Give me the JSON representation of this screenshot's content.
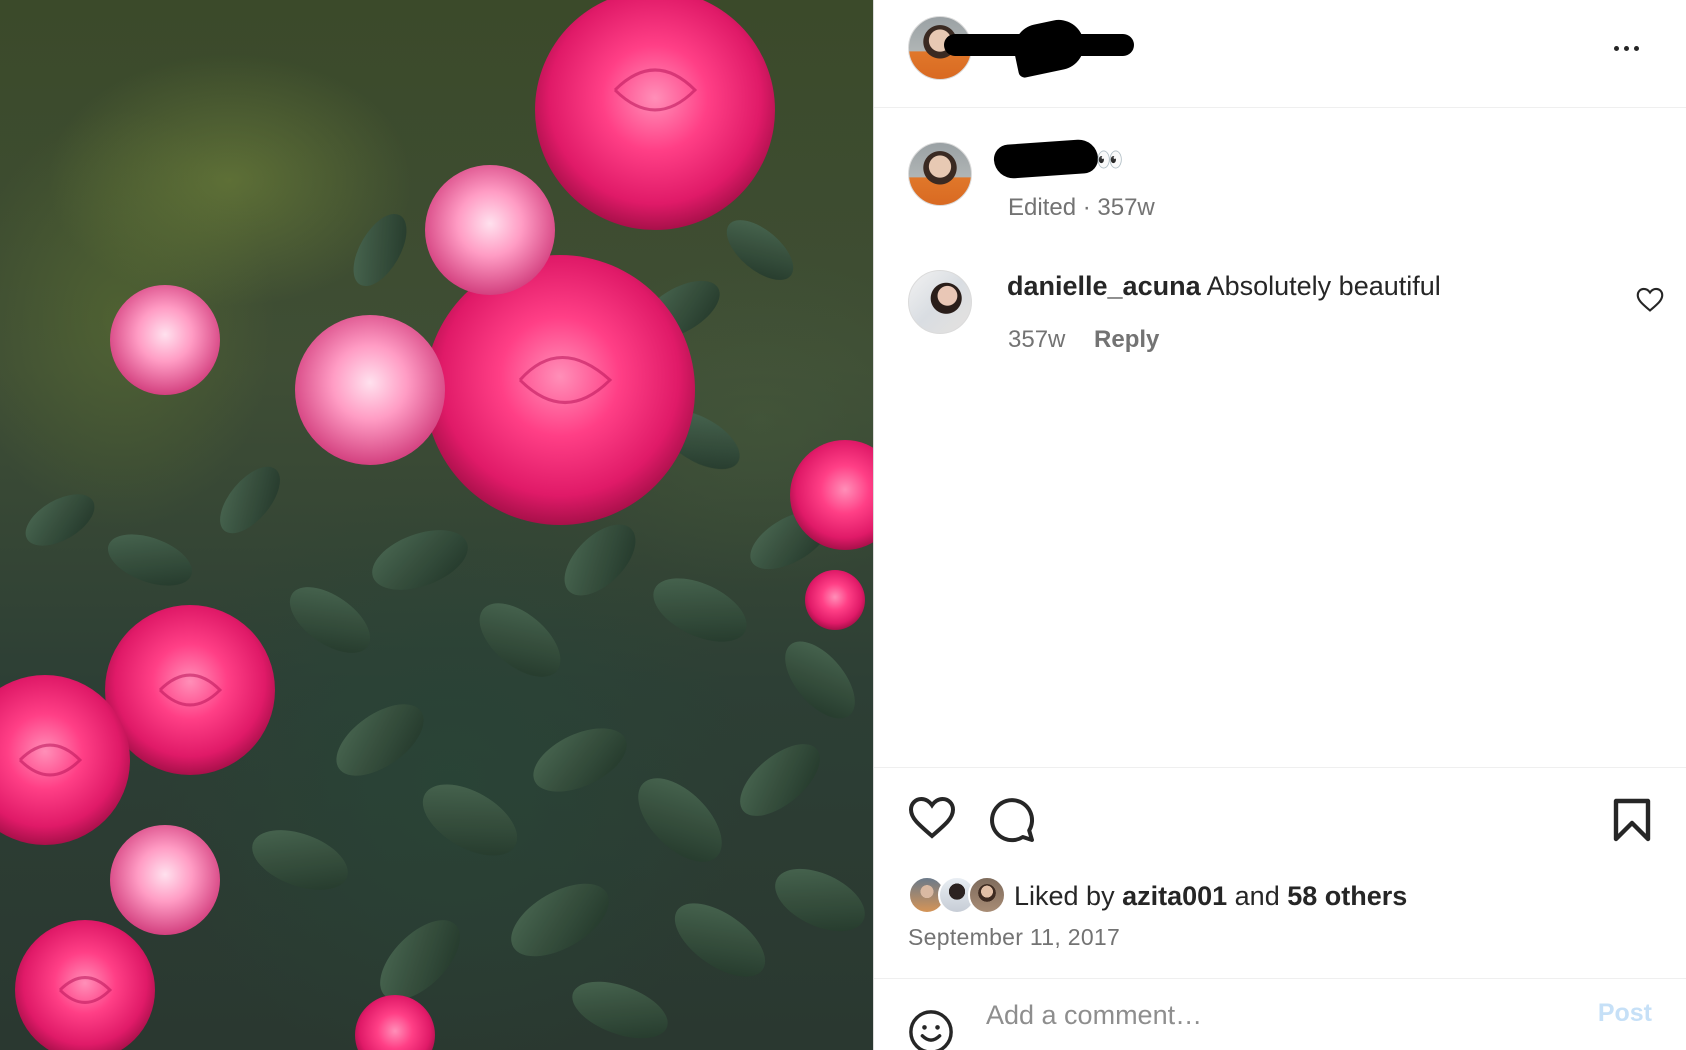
{
  "post": {
    "caption_emoji": "👀",
    "caption_meta": "Edited · 357w",
    "more_icon": "more-horizontal-icon"
  },
  "comments": [
    {
      "username": "danielle_acuna",
      "text": "Absolutely beautiful",
      "age": "357w",
      "reply_label": "Reply"
    }
  ],
  "likes": {
    "prefix": "Liked by ",
    "user": "azita001",
    "middle": " and ",
    "others": "58 others"
  },
  "date": "September 11, 2017",
  "comment_box": {
    "placeholder": "Add a comment…",
    "post_label": "Post"
  },
  "colors": {
    "post_button_disabled": "#c6e0f7",
    "meta_text": "#737373",
    "primary_text": "#262626"
  }
}
